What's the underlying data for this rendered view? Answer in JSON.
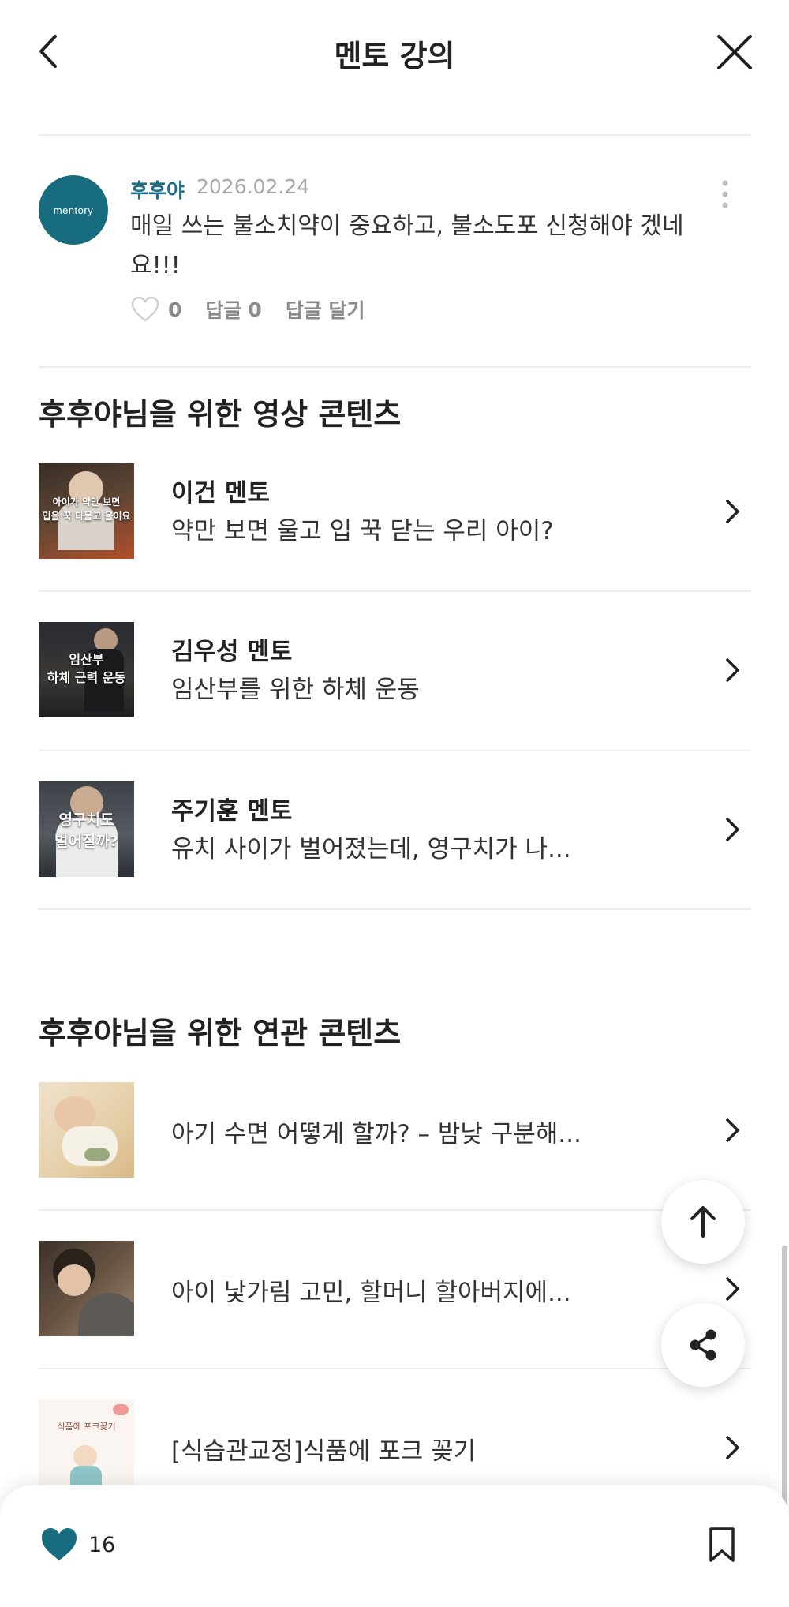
{
  "header": {
    "title": "멘토 강의",
    "back_icon": "chevron-left-icon",
    "close_icon": "close-icon"
  },
  "comment": {
    "avatar_text": "mentory",
    "author": "후후야",
    "date": "2026.02.24",
    "text": "매일  쓰는 불소치약이 중요하고, 불소도포 신청해야 겠네요!!!",
    "like_count": "0",
    "reply_label": "답글",
    "reply_count": "0",
    "write_reply": "답글 달기"
  },
  "video_section": {
    "title": "후후야님을 위한 영상 콘텐츠",
    "items": [
      {
        "mentor": "이건 멘토",
        "desc": "약만 보면 울고 입 꾹 닫는 우리 아이?",
        "thumb_caption_1": "아이가 약만 보면",
        "thumb_caption_2": "입을 꾹 다물고 울어요"
      },
      {
        "mentor": "김우성 멘토",
        "desc": "임산부를 위한 하체 운동",
        "thumb_caption_1": "임산부",
        "thumb_caption_2": "하체 근력 운동"
      },
      {
        "mentor": "주기훈 멘토",
        "desc": "유치 사이가 벌어졌는데, 영구치가 나...",
        "thumb_caption_1": "영구치도",
        "thumb_caption_2": "벌어질까?"
      }
    ]
  },
  "related_section": {
    "title": "후후야님을 위한 연관 콘텐츠",
    "items": [
      {
        "desc": "아기 수면 어떻게 할까? – 밤낮 구분해..."
      },
      {
        "desc": "아이 낯가림 고민, 할머니 할아버지에..."
      },
      {
        "desc": "[식습관교정]식품에 포크 꽂기",
        "thumb_caption": "식품에 포크꽂기"
      }
    ]
  },
  "fab": {
    "top_icon": "arrow-up-icon",
    "share_icon": "share-icon"
  },
  "bottom_bar": {
    "like_count": "16",
    "like_icon": "heart-filled-icon",
    "bookmark_icon": "bookmark-icon"
  },
  "colors": {
    "accent": "#186c80",
    "author": "#1b6f86"
  }
}
